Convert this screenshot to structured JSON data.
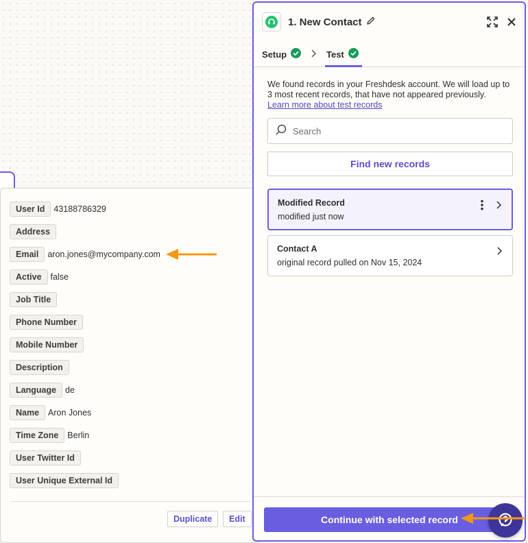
{
  "panel": {
    "title": "1. New Contact",
    "tabs": [
      {
        "label": "Setup"
      },
      {
        "label": "Test"
      }
    ],
    "intro_text": "We found records in your Freshdesk account. We will load up to 3 most recent records, that have not appeared previously.",
    "learn_more_link": "Learn more about test records",
    "search": {
      "placeholder": "Search",
      "value": ""
    },
    "find_button": "Find new records",
    "records": [
      {
        "title": "Modified Record",
        "subtitle": "modified just now"
      },
      {
        "title": "Contact A",
        "subtitle": "original record pulled on Nov 15, 2024"
      }
    ],
    "continue_button": "Continue with selected record"
  },
  "record_detail": {
    "fields": [
      {
        "key": "User Id",
        "value": "43188786329"
      },
      {
        "key": "Address",
        "value": ""
      },
      {
        "key": "Email",
        "value": "aron.jones@mycompany.com"
      },
      {
        "key": "Active",
        "value": "false"
      },
      {
        "key": "Job Title",
        "value": ""
      },
      {
        "key": "Phone Number",
        "value": ""
      },
      {
        "key": "Mobile Number",
        "value": ""
      },
      {
        "key": "Description",
        "value": ""
      },
      {
        "key": "Language",
        "value": "de"
      },
      {
        "key": "Name",
        "value": "Aron Jones"
      },
      {
        "key": "Time Zone",
        "value": "Berlin"
      },
      {
        "key": "User Twitter Id",
        "value": ""
      },
      {
        "key": "User Unique External Id",
        "value": ""
      }
    ],
    "duplicate_button": "Duplicate",
    "edit_button": "Edit"
  },
  "colors": {
    "accent": "#6a5ee0",
    "annotation_arrow": "#f5980f",
    "success": "#1a9a5c"
  },
  "icons": {
    "app_logo": "freshdesk-headset-icon",
    "edit": "pencil-icon",
    "expand": "expand-icon",
    "close": "close-icon",
    "status": "check-circle-icon",
    "search": "search-icon",
    "menu": "kebab-menu-icon",
    "chevron": "chevron-right-icon",
    "help": "help-chat-icon"
  }
}
